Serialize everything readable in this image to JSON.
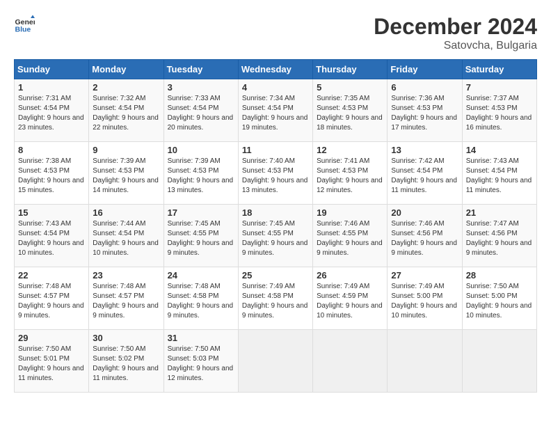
{
  "header": {
    "logo_general": "General",
    "logo_blue": "Blue",
    "month_title": "December 2024",
    "location": "Satovcha, Bulgaria"
  },
  "weekdays": [
    "Sunday",
    "Monday",
    "Tuesday",
    "Wednesday",
    "Thursday",
    "Friday",
    "Saturday"
  ],
  "weeks": [
    [
      {
        "day": "1",
        "sunrise": "Sunrise: 7:31 AM",
        "sunset": "Sunset: 4:54 PM",
        "daylight": "Daylight: 9 hours and 23 minutes."
      },
      {
        "day": "2",
        "sunrise": "Sunrise: 7:32 AM",
        "sunset": "Sunset: 4:54 PM",
        "daylight": "Daylight: 9 hours and 22 minutes."
      },
      {
        "day": "3",
        "sunrise": "Sunrise: 7:33 AM",
        "sunset": "Sunset: 4:54 PM",
        "daylight": "Daylight: 9 hours and 20 minutes."
      },
      {
        "day": "4",
        "sunrise": "Sunrise: 7:34 AM",
        "sunset": "Sunset: 4:54 PM",
        "daylight": "Daylight: 9 hours and 19 minutes."
      },
      {
        "day": "5",
        "sunrise": "Sunrise: 7:35 AM",
        "sunset": "Sunset: 4:53 PM",
        "daylight": "Daylight: 9 hours and 18 minutes."
      },
      {
        "day": "6",
        "sunrise": "Sunrise: 7:36 AM",
        "sunset": "Sunset: 4:53 PM",
        "daylight": "Daylight: 9 hours and 17 minutes."
      },
      {
        "day": "7",
        "sunrise": "Sunrise: 7:37 AM",
        "sunset": "Sunset: 4:53 PM",
        "daylight": "Daylight: 9 hours and 16 minutes."
      }
    ],
    [
      {
        "day": "8",
        "sunrise": "Sunrise: 7:38 AM",
        "sunset": "Sunset: 4:53 PM",
        "daylight": "Daylight: 9 hours and 15 minutes."
      },
      {
        "day": "9",
        "sunrise": "Sunrise: 7:39 AM",
        "sunset": "Sunset: 4:53 PM",
        "daylight": "Daylight: 9 hours and 14 minutes."
      },
      {
        "day": "10",
        "sunrise": "Sunrise: 7:39 AM",
        "sunset": "Sunset: 4:53 PM",
        "daylight": "Daylight: 9 hours and 13 minutes."
      },
      {
        "day": "11",
        "sunrise": "Sunrise: 7:40 AM",
        "sunset": "Sunset: 4:53 PM",
        "daylight": "Daylight: 9 hours and 13 minutes."
      },
      {
        "day": "12",
        "sunrise": "Sunrise: 7:41 AM",
        "sunset": "Sunset: 4:53 PM",
        "daylight": "Daylight: 9 hours and 12 minutes."
      },
      {
        "day": "13",
        "sunrise": "Sunrise: 7:42 AM",
        "sunset": "Sunset: 4:54 PM",
        "daylight": "Daylight: 9 hours and 11 minutes."
      },
      {
        "day": "14",
        "sunrise": "Sunrise: 7:43 AM",
        "sunset": "Sunset: 4:54 PM",
        "daylight": "Daylight: 9 hours and 11 minutes."
      }
    ],
    [
      {
        "day": "15",
        "sunrise": "Sunrise: 7:43 AM",
        "sunset": "Sunset: 4:54 PM",
        "daylight": "Daylight: 9 hours and 10 minutes."
      },
      {
        "day": "16",
        "sunrise": "Sunrise: 7:44 AM",
        "sunset": "Sunset: 4:54 PM",
        "daylight": "Daylight: 9 hours and 10 minutes."
      },
      {
        "day": "17",
        "sunrise": "Sunrise: 7:45 AM",
        "sunset": "Sunset: 4:55 PM",
        "daylight": "Daylight: 9 hours and 9 minutes."
      },
      {
        "day": "18",
        "sunrise": "Sunrise: 7:45 AM",
        "sunset": "Sunset: 4:55 PM",
        "daylight": "Daylight: 9 hours and 9 minutes."
      },
      {
        "day": "19",
        "sunrise": "Sunrise: 7:46 AM",
        "sunset": "Sunset: 4:55 PM",
        "daylight": "Daylight: 9 hours and 9 minutes."
      },
      {
        "day": "20",
        "sunrise": "Sunrise: 7:46 AM",
        "sunset": "Sunset: 4:56 PM",
        "daylight": "Daylight: 9 hours and 9 minutes."
      },
      {
        "day": "21",
        "sunrise": "Sunrise: 7:47 AM",
        "sunset": "Sunset: 4:56 PM",
        "daylight": "Daylight: 9 hours and 9 minutes."
      }
    ],
    [
      {
        "day": "22",
        "sunrise": "Sunrise: 7:48 AM",
        "sunset": "Sunset: 4:57 PM",
        "daylight": "Daylight: 9 hours and 9 minutes."
      },
      {
        "day": "23",
        "sunrise": "Sunrise: 7:48 AM",
        "sunset": "Sunset: 4:57 PM",
        "daylight": "Daylight: 9 hours and 9 minutes."
      },
      {
        "day": "24",
        "sunrise": "Sunrise: 7:48 AM",
        "sunset": "Sunset: 4:58 PM",
        "daylight": "Daylight: 9 hours and 9 minutes."
      },
      {
        "day": "25",
        "sunrise": "Sunrise: 7:49 AM",
        "sunset": "Sunset: 4:58 PM",
        "daylight": "Daylight: 9 hours and 9 minutes."
      },
      {
        "day": "26",
        "sunrise": "Sunrise: 7:49 AM",
        "sunset": "Sunset: 4:59 PM",
        "daylight": "Daylight: 9 hours and 10 minutes."
      },
      {
        "day": "27",
        "sunrise": "Sunrise: 7:49 AM",
        "sunset": "Sunset: 5:00 PM",
        "daylight": "Daylight: 9 hours and 10 minutes."
      },
      {
        "day": "28",
        "sunrise": "Sunrise: 7:50 AM",
        "sunset": "Sunset: 5:00 PM",
        "daylight": "Daylight: 9 hours and 10 minutes."
      }
    ],
    [
      {
        "day": "29",
        "sunrise": "Sunrise: 7:50 AM",
        "sunset": "Sunset: 5:01 PM",
        "daylight": "Daylight: 9 hours and 11 minutes."
      },
      {
        "day": "30",
        "sunrise": "Sunrise: 7:50 AM",
        "sunset": "Sunset: 5:02 PM",
        "daylight": "Daylight: 9 hours and 11 minutes."
      },
      {
        "day": "31",
        "sunrise": "Sunrise: 7:50 AM",
        "sunset": "Sunset: 5:03 PM",
        "daylight": "Daylight: 9 hours and 12 minutes."
      },
      null,
      null,
      null,
      null
    ]
  ]
}
